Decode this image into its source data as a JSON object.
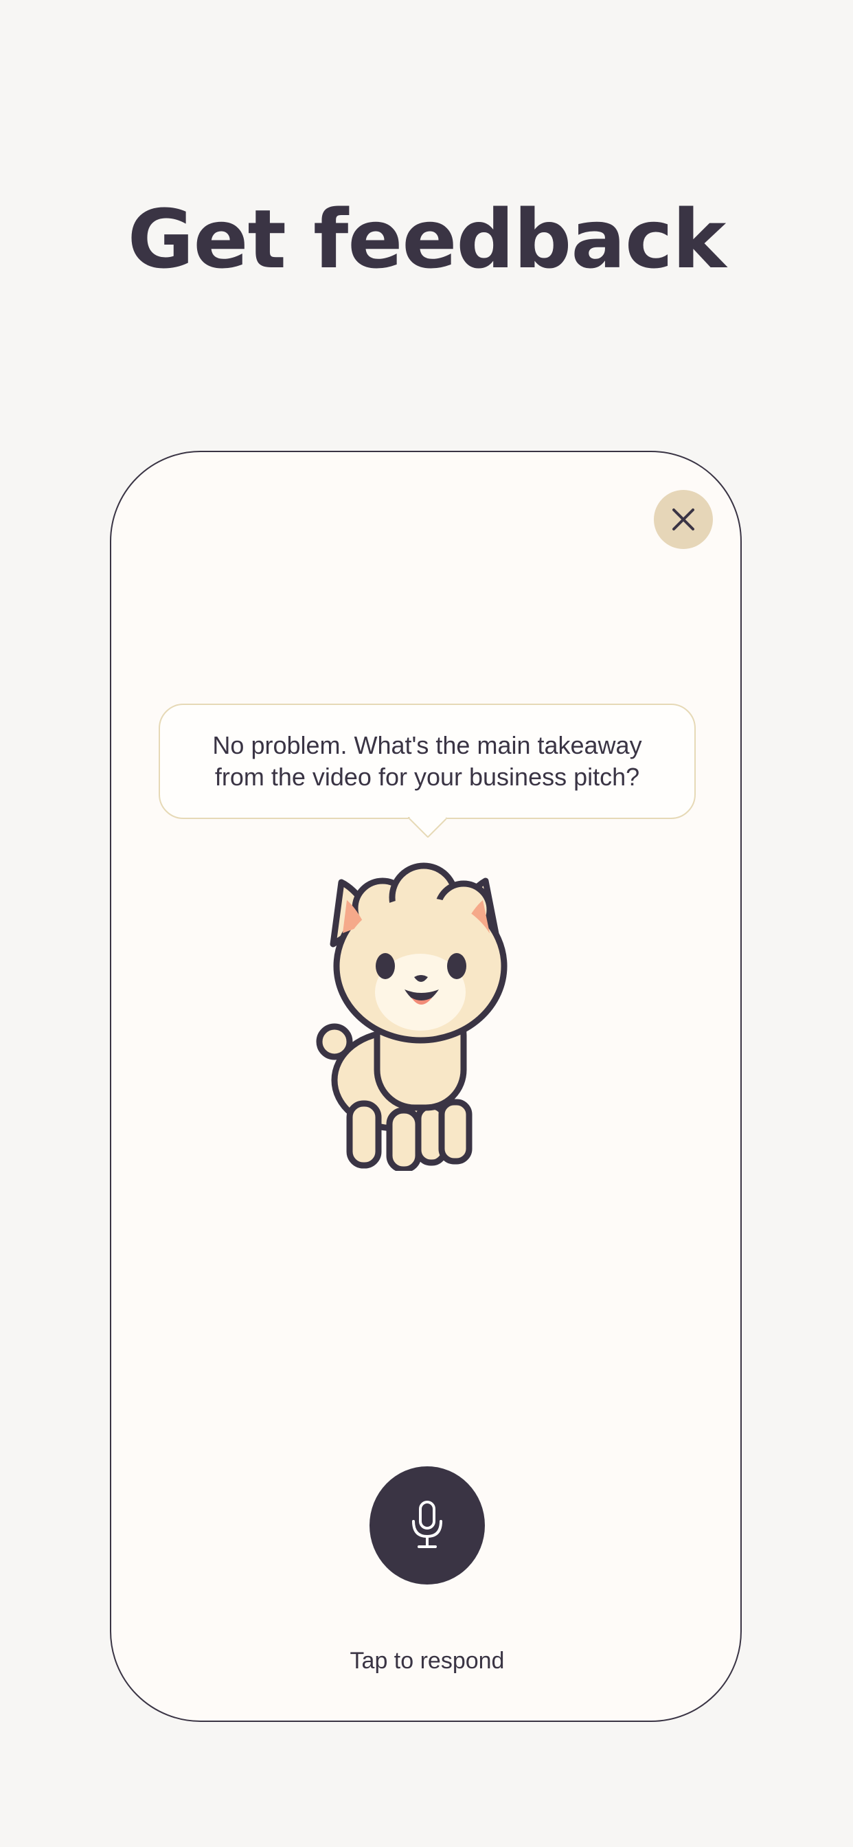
{
  "header": {
    "title": "Get feedback"
  },
  "card": {
    "close_icon": "close-icon",
    "speech_bubble": {
      "line1": "No problem. What's the main takeaway",
      "line2": "from the video for your business pitch?"
    },
    "mascot": "llama-illustration",
    "mic_icon": "microphone-icon",
    "tap_label": "Tap to respond"
  },
  "colors": {
    "background": "#f7f6f4",
    "card_background": "#fefbf8",
    "text": "#3a3444",
    "close_button": "#e6d6b8",
    "mic_button": "#3a3444",
    "bubble_border": "#e6d9b6"
  }
}
